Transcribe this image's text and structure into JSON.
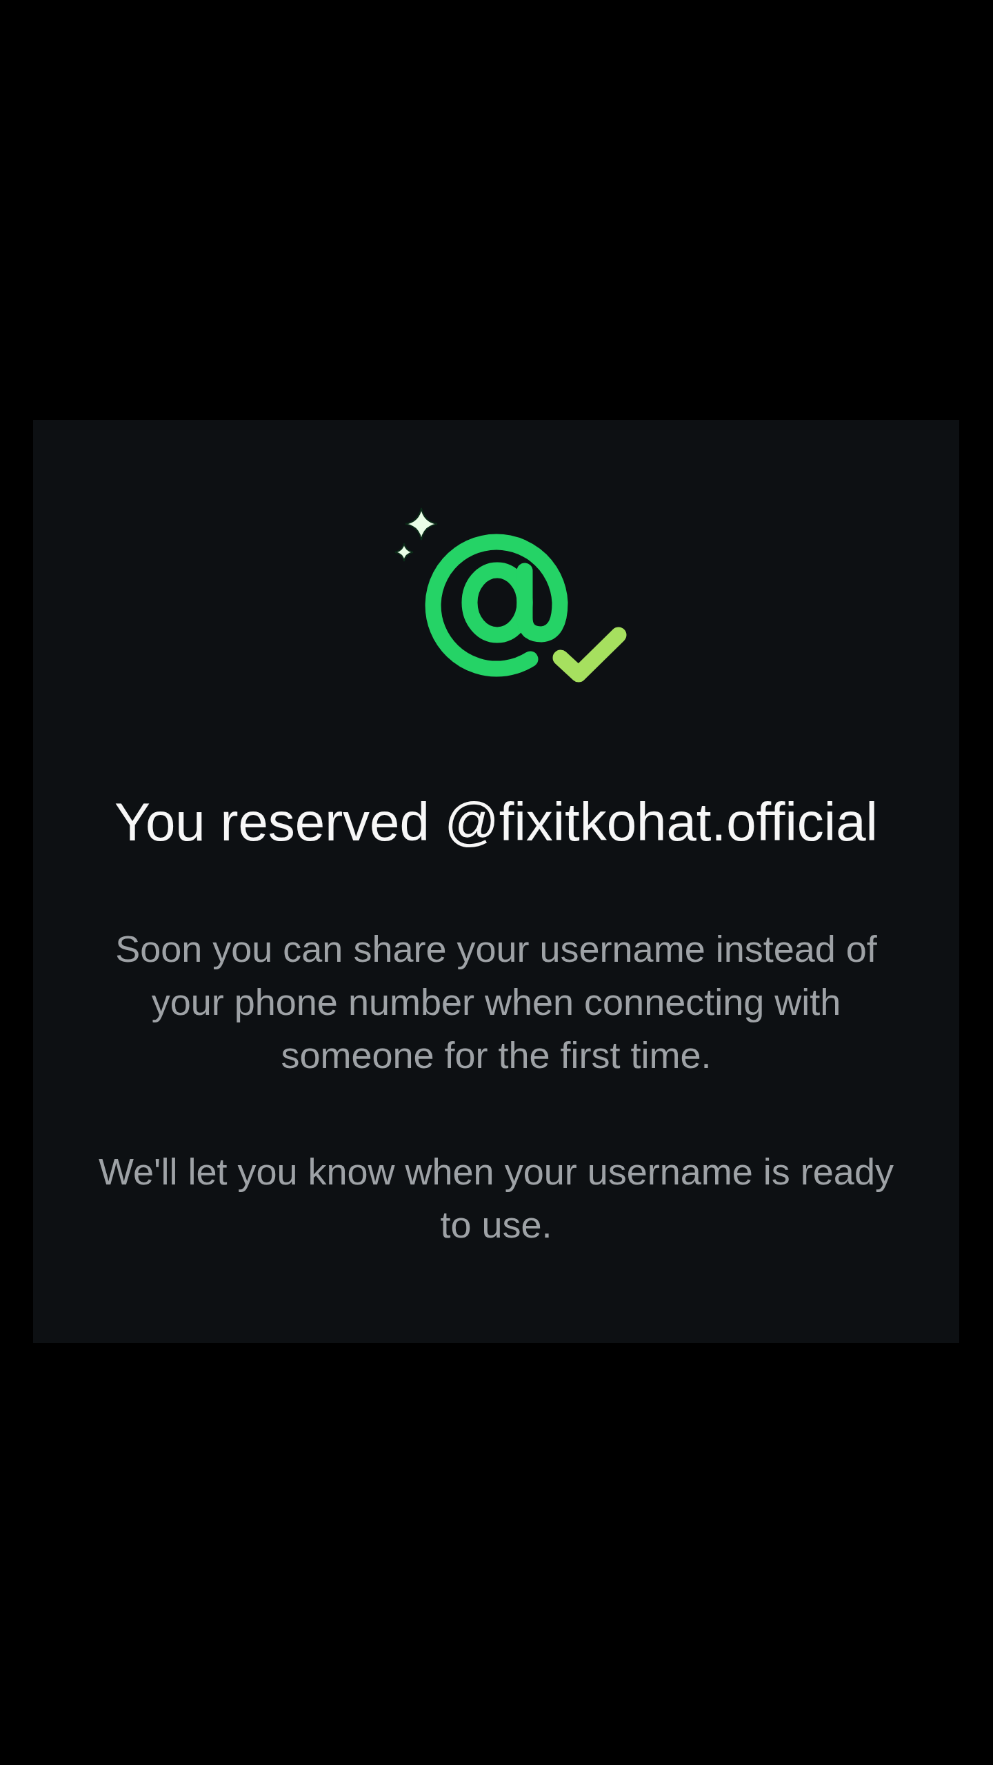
{
  "dialog": {
    "title": "You reserved @fixitkohat.official",
    "paragraphs": [
      "Soon you can share your username instead of your phone number when connecting with someone for the first time.",
      "We'll let you know when your username is ready to use."
    ]
  }
}
